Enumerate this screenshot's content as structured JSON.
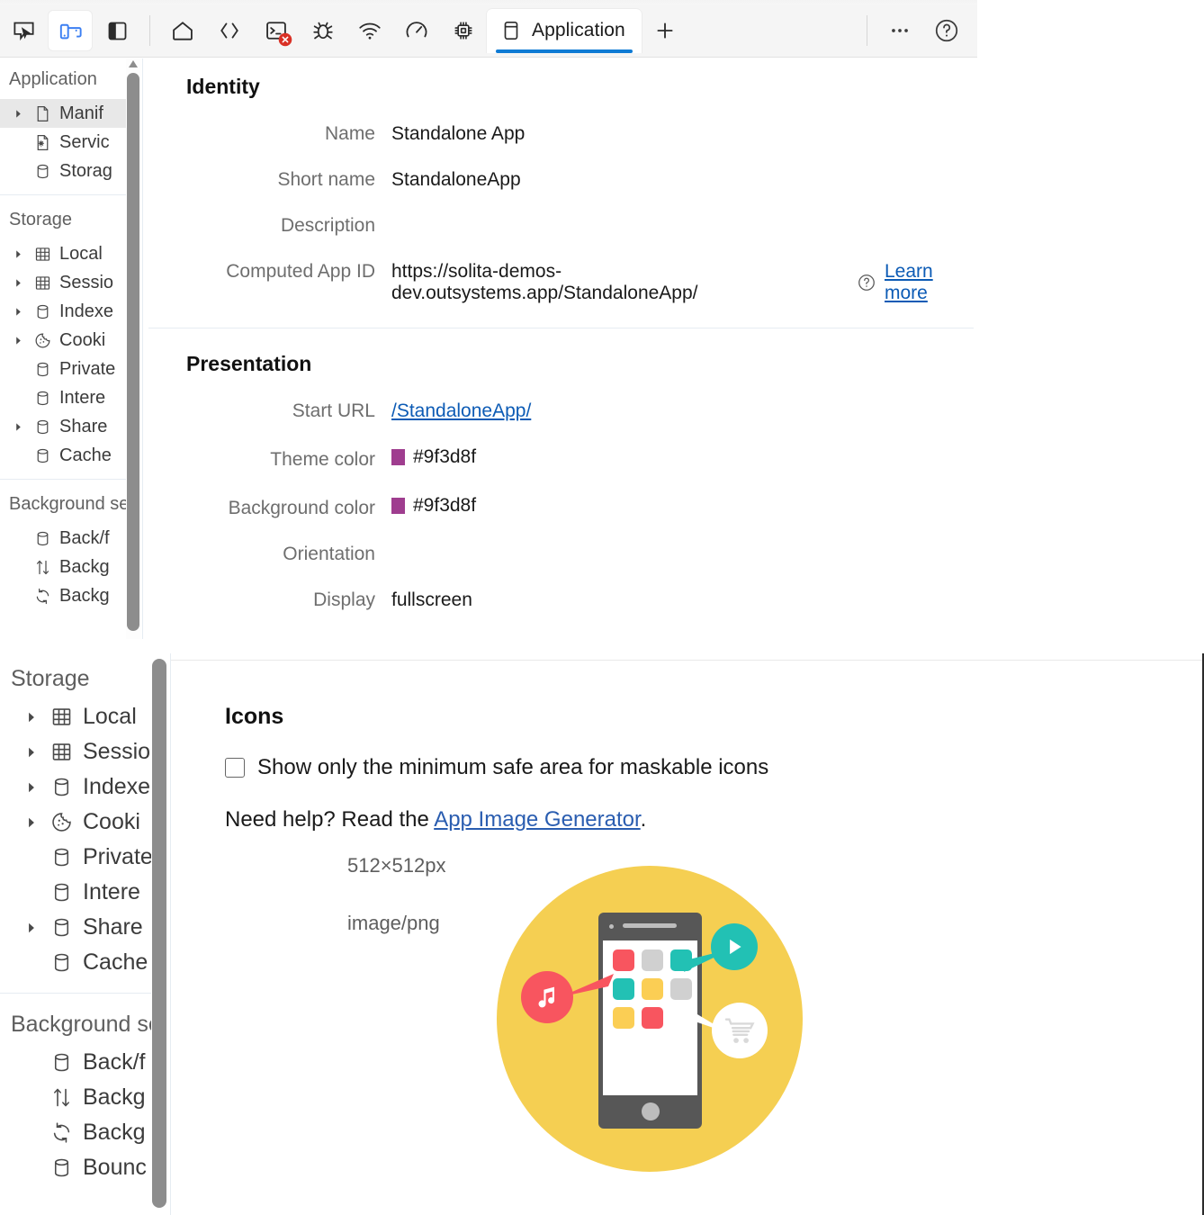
{
  "toolbar": {
    "icons": [
      {
        "name": "inspect-element-icon",
        "title": "Inspect"
      },
      {
        "name": "device-emulation-icon",
        "title": "Device emulation"
      },
      {
        "name": "dock-side-icon",
        "title": "Dock side"
      }
    ],
    "tabs": [
      {
        "name": "welcome-icon",
        "label": ""
      },
      {
        "name": "elements-icon",
        "label": ""
      },
      {
        "name": "console-icon",
        "label": "",
        "error_badge": true
      },
      {
        "name": "debugger-icon",
        "label": ""
      },
      {
        "name": "network-icon",
        "label": ""
      },
      {
        "name": "performance-icon",
        "label": ""
      },
      {
        "name": "memory-icon",
        "label": ""
      }
    ],
    "active_tab": "Application",
    "add_tab_label": "+",
    "more_label": "···",
    "help_label": "?"
  },
  "top_sidebar": {
    "sections": [
      {
        "title": "Application",
        "items": [
          {
            "label": "Manif",
            "icon": "manifest-file-icon",
            "arrow": true,
            "selected": true
          },
          {
            "label": "Servic",
            "icon": "service-worker-icon",
            "arrow": false,
            "selected": false
          },
          {
            "label": "Storag",
            "icon": "storage-icon",
            "arrow": false,
            "selected": false
          }
        ]
      },
      {
        "title": "Storage",
        "items": [
          {
            "label": "Local",
            "icon": "table-icon",
            "arrow": true,
            "selected": false
          },
          {
            "label": "Sessio",
            "icon": "table-icon",
            "arrow": true,
            "selected": false
          },
          {
            "label": "Indexe",
            "icon": "database-icon",
            "arrow": true,
            "selected": false
          },
          {
            "label": "Cooki",
            "icon": "cookie-icon",
            "arrow": true,
            "selected": false
          },
          {
            "label": "Private",
            "icon": "database-icon",
            "arrow": false,
            "selected": false
          },
          {
            "label": "Intere",
            "icon": "database-icon",
            "arrow": false,
            "selected": false
          },
          {
            "label": "Share",
            "icon": "database-icon",
            "arrow": true,
            "selected": false
          },
          {
            "label": "Cache",
            "icon": "database-icon",
            "arrow": false,
            "selected": false
          }
        ]
      },
      {
        "title": "Background se",
        "items": [
          {
            "label": "Back/f",
            "icon": "database-icon",
            "arrow": false,
            "selected": false
          },
          {
            "label": "Backg",
            "icon": "arrows-up-down-icon",
            "arrow": false,
            "selected": false
          },
          {
            "label": "Backg",
            "icon": "sync-icon",
            "arrow": false,
            "selected": false
          }
        ]
      }
    ]
  },
  "identity": {
    "title": "Identity",
    "fields": [
      {
        "label": "Name",
        "value": "Standalone App",
        "type": "text"
      },
      {
        "label": "Short name",
        "value": "StandaloneApp",
        "type": "text"
      },
      {
        "label": "Description",
        "value": "",
        "type": "text"
      },
      {
        "label": "Computed App ID",
        "value": "https://solita-demos-dev.outsystems.app/StandaloneApp/",
        "type": "appid",
        "help_icon": "help-circle-icon",
        "link_label": "Learn more"
      }
    ]
  },
  "presentation": {
    "title": "Presentation",
    "fields": [
      {
        "label": "Start URL",
        "value": "/StandaloneApp/",
        "type": "link"
      },
      {
        "label": "Theme color",
        "value": "#9f3d8f",
        "type": "color",
        "swatch": "#9f3d8f"
      },
      {
        "label": "Background color",
        "value": "#9f3d8f",
        "type": "color",
        "swatch": "#9f3d8f"
      },
      {
        "label": "Orientation",
        "value": "",
        "type": "text"
      },
      {
        "label": "Display",
        "value": "fullscreen",
        "type": "text"
      }
    ]
  },
  "bottom_sidebar": {
    "sections": [
      {
        "title": "Storage",
        "items": [
          {
            "label": "Local",
            "icon": "table-icon",
            "arrow": true
          },
          {
            "label": "Sessio",
            "icon": "table-icon",
            "arrow": true
          },
          {
            "label": "Indexe",
            "icon": "database-icon",
            "arrow": true
          },
          {
            "label": "Cooki",
            "icon": "cookie-icon",
            "arrow": true
          },
          {
            "label": "Private",
            "icon": "database-icon",
            "arrow": false
          },
          {
            "label": "Intere",
            "icon": "database-icon",
            "arrow": false
          },
          {
            "label": "Share",
            "icon": "database-icon",
            "arrow": true
          },
          {
            "label": "Cache",
            "icon": "database-icon",
            "arrow": false
          }
        ]
      },
      {
        "title": "Background se",
        "items": [
          {
            "label": "Back/f",
            "icon": "database-icon",
            "arrow": false
          },
          {
            "label": "Backg",
            "icon": "arrows-up-down-icon",
            "arrow": false
          },
          {
            "label": "Backg",
            "icon": "sync-icon",
            "arrow": false
          },
          {
            "label": "Bounc",
            "icon": "database-icon",
            "arrow": false
          }
        ]
      }
    ]
  },
  "icons_section": {
    "title": "Icons",
    "checkbox_label": "Show only the minimum safe area for maskable icons",
    "checkbox_checked": false,
    "help_prefix": "Need help? Read the ",
    "help_link": "App Image Generator",
    "help_suffix": ".",
    "icon_size": "512×512px",
    "icon_mime": "image/png",
    "artwork": {
      "background": "#f5cf52",
      "phone_body": "#575757",
      "tiles": [
        "#f8555f",
        "#d0d0d0",
        "#22c1b4",
        "#22c1b4",
        "#fbce54",
        "#d0d0d0",
        "#fbce54",
        "#f8555f",
        "transparent"
      ],
      "badges": [
        {
          "name": "music-badge",
          "color": "#f8555f",
          "glyph": "music-note-icon"
        },
        {
          "name": "play-badge",
          "color": "#22c1b4",
          "glyph": "play-icon"
        },
        {
          "name": "cart-badge",
          "color": "#ffffff",
          "glyph": "shopping-cart-icon"
        }
      ]
    }
  }
}
